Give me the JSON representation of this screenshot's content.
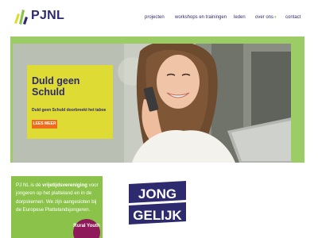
{
  "brand": {
    "name": "PJNL",
    "colors": {
      "navy": "#2d2a6e",
      "green": "#8bc34a",
      "yellow": "#dfdb35",
      "orange": "#f26b1d",
      "purple": "#8e1a5a"
    }
  },
  "nav": {
    "items": [
      {
        "label": "projecten"
      },
      {
        "label": "workshops en trainingen"
      },
      {
        "label": "leden"
      },
      {
        "label": "over ons",
        "icon": "chevron-down-icon"
      },
      {
        "label": "contact"
      }
    ]
  },
  "hero": {
    "title": "Duld geen Schuld",
    "subtitle": "Duld geen Schuld doorbreekt het taboe",
    "button": "LEES MEER"
  },
  "intro": {
    "lead": "PJ NL is dé ",
    "highlight": "vrijetijdsvereniging",
    "rest": " voor jongeren op het platteland en in de dorpskernen. We zijn aangesloten bij de Europese Plattelandsjongeren."
  },
  "badges": {
    "rural": "Rural Youth",
    "jong_gelijk": [
      "JONG",
      "GELIJK"
    ]
  }
}
